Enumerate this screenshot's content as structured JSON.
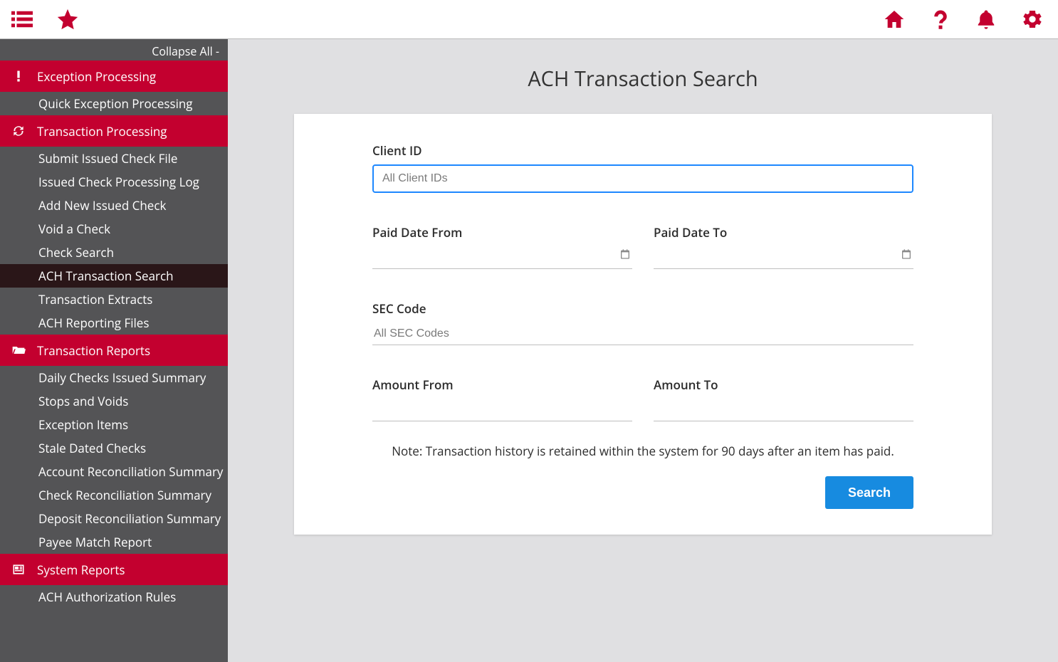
{
  "sidebar": {
    "collapse_label": "Collapse All -",
    "sections": [
      {
        "label": "Exception Processing",
        "items": [
          {
            "label": "Quick Exception Processing",
            "active": false
          }
        ]
      },
      {
        "label": "Transaction Processing",
        "items": [
          {
            "label": "Submit Issued Check File",
            "active": false
          },
          {
            "label": "Issued Check Processing Log",
            "active": false
          },
          {
            "label": "Add New Issued Check",
            "active": false
          },
          {
            "label": "Void a Check",
            "active": false
          },
          {
            "label": "Check Search",
            "active": false
          },
          {
            "label": "ACH Transaction Search",
            "active": true
          },
          {
            "label": "Transaction Extracts",
            "active": false
          },
          {
            "label": "ACH Reporting Files",
            "active": false
          }
        ]
      },
      {
        "label": "Transaction Reports",
        "items": [
          {
            "label": "Daily Checks Issued Summary",
            "active": false
          },
          {
            "label": "Stops and Voids",
            "active": false
          },
          {
            "label": "Exception Items",
            "active": false
          },
          {
            "label": "Stale Dated Checks",
            "active": false
          },
          {
            "label": "Account Reconciliation Summary",
            "active": false
          },
          {
            "label": "Check Reconciliation Summary",
            "active": false
          },
          {
            "label": "Deposit Reconciliation Summary",
            "active": false
          },
          {
            "label": "Payee Match Report",
            "active": false
          }
        ]
      },
      {
        "label": "System Reports",
        "items": [
          {
            "label": "ACH Authorization Rules",
            "active": false
          }
        ]
      }
    ]
  },
  "page": {
    "title": "ACH Transaction Search",
    "note": "Note: Transaction history is retained within the system for 90 days after an item has paid.",
    "search_button": "Search"
  },
  "form": {
    "client_id": {
      "label": "Client ID",
      "placeholder": "All Client IDs",
      "value": ""
    },
    "paid_from": {
      "label": "Paid Date From",
      "value": ""
    },
    "paid_to": {
      "label": "Paid Date To",
      "value": ""
    },
    "sec_code": {
      "label": "SEC Code",
      "placeholder": "All SEC Codes",
      "value": ""
    },
    "amount_from": {
      "label": "Amount From",
      "value": ""
    },
    "amount_to": {
      "label": "Amount To",
      "value": ""
    }
  }
}
